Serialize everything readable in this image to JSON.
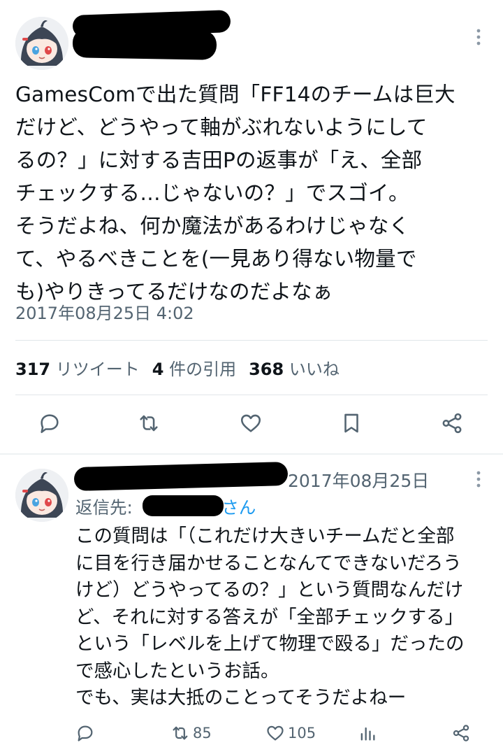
{
  "main_tweet": {
    "text": "GamesComで出た質問「FF14のチームは巨大\nだけど、どうやって軸がぶれないようにして\nるの？」に対する吉田Pの返事が「え、全部\nチェックする…じゃないの？」でスゴイ。\nそうだよね、何か魔法があるわけじゃなく\nて、やるべきことを(一見あり得ない物量で\nも)やりきってるだけなのだよなぁ",
    "timestamp": "2017年08月25日 4:02",
    "stats": {
      "retweets_count": "317",
      "retweets_label": "リツイート",
      "quotes_count": "4",
      "quotes_label": "件の引用",
      "likes_count": "368",
      "likes_label": "いいね"
    },
    "actions": [
      "reply",
      "retweet",
      "like",
      "bookmark",
      "share"
    ]
  },
  "reply_tweet": {
    "timestamp": "2017年08月25日",
    "reply_to_label": "返信先:",
    "reply_to_suffix": "3さん",
    "text": "この質問は「（これだけ大きいチームだと全部\nに目を行き届かせることなんてできないだろう\nけど）どうやってるの？」という質問なんだけ\nど、それに対する答えが「全部チェックする」\nという「レベルを上げて物理で殴る」だったの\nで感心したというお話。\nでも、実は大抵のことってそうだよねー",
    "retweets": "85",
    "likes": "105"
  },
  "colors": {
    "text": "#0f1419",
    "secondary": "#536471",
    "link": "#1d9bf0",
    "divider": "#e1e6ea"
  },
  "icons": [
    "more-vert-icon",
    "reply-icon",
    "retweet-icon",
    "heart-icon",
    "bookmark-icon",
    "share-icon",
    "analytics-icon"
  ]
}
